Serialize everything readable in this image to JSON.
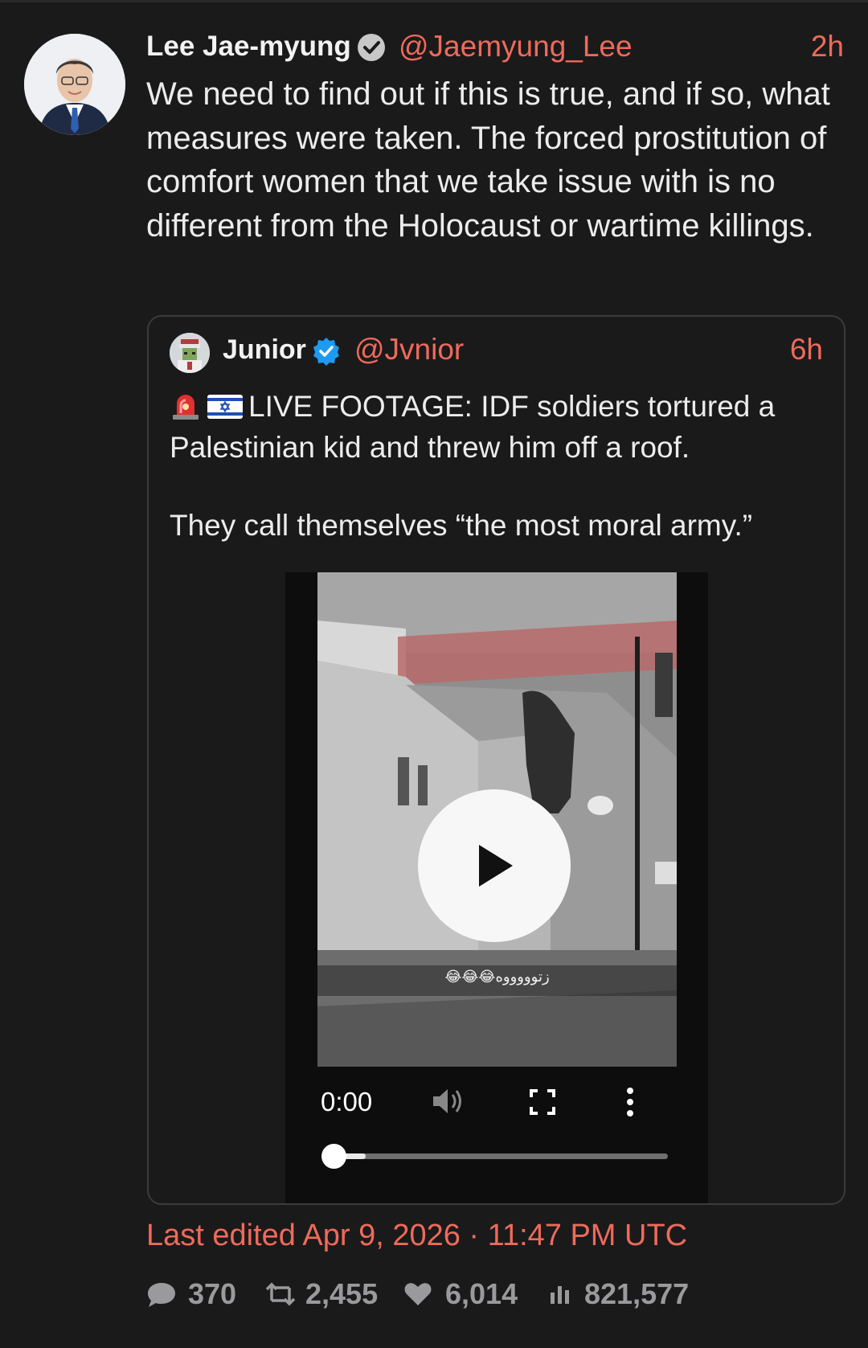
{
  "post": {
    "author_name": "Lee Jae-myung",
    "author_handle": "@Jaemyung_Lee",
    "time": "2h",
    "text": "We need to find out if this is true, and if so, what measures were taken. The forced prostitution of comfort women that we take issue with is no different from the Holocaust or wartime killings.",
    "edited": "Last edited Apr 9, 2026 · 11:47 PM UTC",
    "stats": {
      "replies": "370",
      "retweets": "2,455",
      "likes": "6,014",
      "views": "821,577"
    }
  },
  "quote": {
    "author_name": "Junior",
    "author_handle": "@Jvnior",
    "time": "6h",
    "line1": "LIVE FOOTAGE: IDF soldiers tortured a",
    "line2": "Palestinian kid and threw him off a roof.",
    "line3": "They call themselves “the most moral army.”",
    "video": {
      "caption": "😂😂😂زتوووووه",
      "time": "0:00",
      "progress": 0.0
    }
  },
  "colors": {
    "background": "#1a1a1b",
    "accent": "#ef6a5a",
    "verified_blue": "#1d9bf0",
    "muted": "#9a9a9c"
  },
  "icons": [
    "verified-badge-icon",
    "siren-emoji-icon",
    "israel-flag-emoji-icon",
    "play-icon",
    "volume-icon",
    "fullscreen-icon",
    "more-vertical-icon",
    "reply-icon",
    "retweet-icon",
    "like-icon",
    "views-icon"
  ]
}
